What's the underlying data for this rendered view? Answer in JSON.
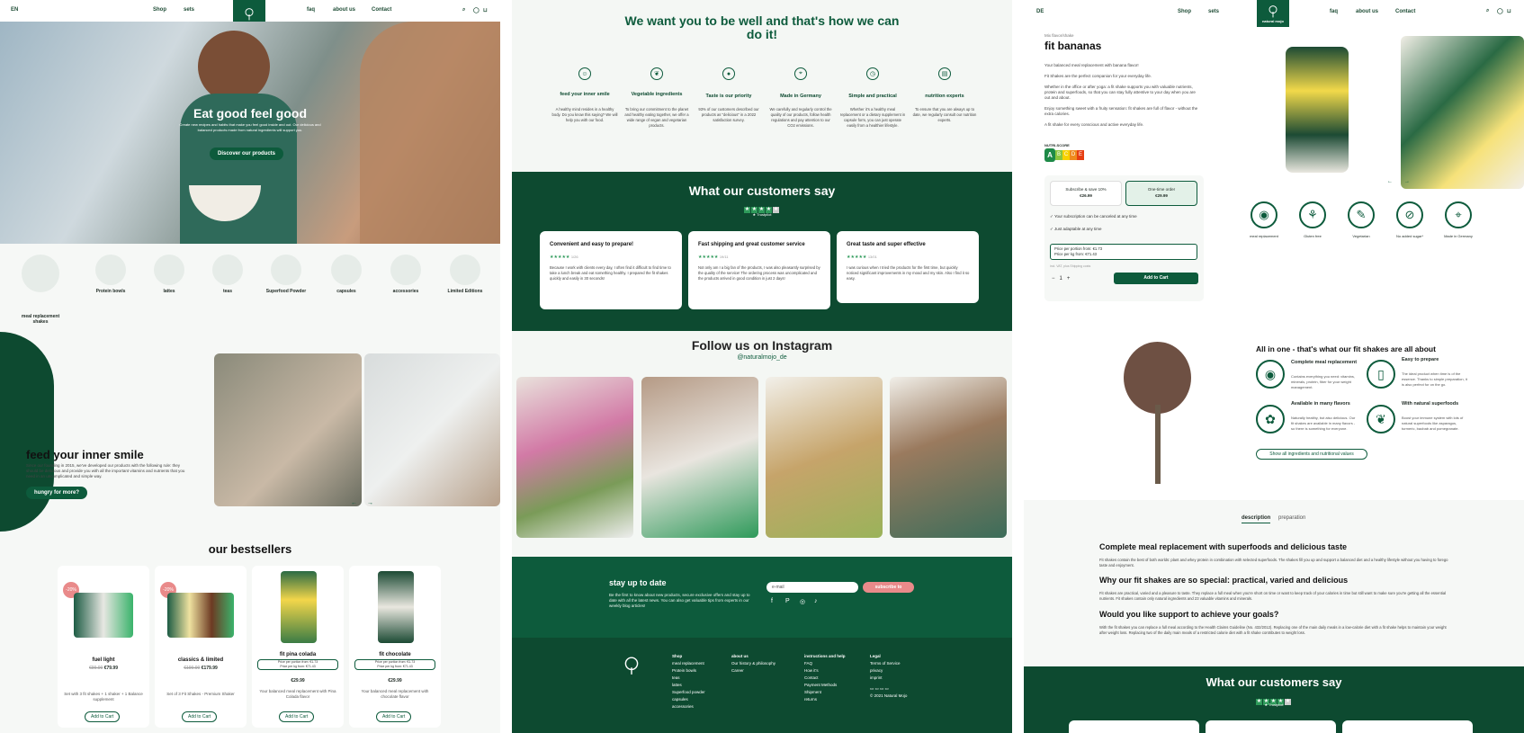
{
  "nav": {
    "lang": "EN",
    "shop": "Shop",
    "sets": "sets",
    "faq": "faq",
    "about": "about us",
    "contact": "Contact",
    "logo_text": "natural mojo",
    "lang2": "DE"
  },
  "hero": {
    "title": "Eat good feel good",
    "subtitle": "Create new recipes and habits that make you feel good inside and out. Our delicious and balanced products made from natural ingredients will support you.",
    "cta": "Discover our products"
  },
  "categories": [
    {
      "label": "meal replacement shakes"
    },
    {
      "label": "Protein bowls"
    },
    {
      "label": "lattes"
    },
    {
      "label": "teas"
    },
    {
      "label": "Superfood Powder"
    },
    {
      "label": "capsules"
    },
    {
      "label": "accessories"
    },
    {
      "label": "Limited Editions"
    }
  ],
  "inner_smile": {
    "title": "feed your inner smile",
    "text": "Since our founding in 2015, we've developed our products with the following rule: they should be delicious and provide you with all the important vitamins and nutrients that you need in an uncomplicated and simple way.",
    "cta": "hungry for more?"
  },
  "bestsellers": {
    "title": "our bestsellers",
    "products": [
      {
        "name": "fuel light",
        "price": "€79.99",
        "old": "€99.99",
        "badge": "-20%",
        "desc": "Set with 3 fit shakes + 1 shaker + 1 Balance supplement",
        "cta": "Add to Cart"
      },
      {
        "name": "classics & limited",
        "price": "€179.99",
        "old": "€199.99",
        "badge": "-20%",
        "desc": "Set of 3 Fit Shakes - Premium Shaker",
        "cta": "Add to Cart"
      },
      {
        "name": "fit pina colada",
        "price": "€29.99",
        "sub1": "Price per portion from: €1.73",
        "sub2": "Price per kg from: €71.43",
        "desc": "Your balanced meal replacement with Pina Colada flavor",
        "cta": "Add to Cart"
      },
      {
        "name": "fit chocolate",
        "price": "€29.99",
        "sub1": "Price per portion from: €1.73",
        "sub2": "Price per kg from: €71.43",
        "desc": "Your balanced meal replacement with chocolate flavor",
        "cta": "Add to Cart"
      }
    ]
  },
  "values": {
    "title": "We want you to be well and that's how we can do it!",
    "items": [
      {
        "title": "feed your inner smile",
        "text": "A healthy mind resides in a healthy body. Do you know this saying? We will help you with our food.",
        "icon": "smile-icon"
      },
      {
        "title": "Vegetable ingredients",
        "text": "To bring our commitment to the planet and healthy eating together, we offer a wide range of vegan and vegetarian products.",
        "icon": "leaf-icon"
      },
      {
        "title": "Taste is our priority",
        "text": "93% of our customers described our products as \"delicious\" in a 2022 satisfaction survey.",
        "icon": "apple-icon"
      },
      {
        "title": "Made in Germany",
        "text": "We carefully and regularly control the quality of our products, follow health regulations and pay attention to our CO2 emissions.",
        "icon": "pin-icon"
      },
      {
        "title": "Simple and practical",
        "text": "Whether it's a healthy meal replacement or a dietary supplement in capsule form, you can just operate easily from a healthier lifestyle.",
        "icon": "clock-icon"
      },
      {
        "title": "nutrition experts",
        "text": "To ensure that you are always up to date, we regularly consult our nutrition experts.",
        "icon": "book-icon"
      }
    ]
  },
  "reviews": {
    "title": "What our customers say",
    "trustpilot": "Trustpilot",
    "items": [
      {
        "title": "Convenient and easy to prepare!",
        "date": "1/26",
        "text": "Because I work with clients every day, I often find it difficult to find time to take a lunch break and eat something healthy. I prepared the fit shakes quickly and easily in 30 seconds!"
      },
      {
        "title": "Fast shipping and great customer service",
        "date": "19/11",
        "text": "Not only am I a big fan of the products, I was also pleasantly surprised by the quality of the service! The ordering process was uncomplicated and the products arrived in good condition in just 2 days!"
      },
      {
        "title": "Great taste and super effective",
        "date": "13/01",
        "text": "I was curious when I tried the products for the first time, but quickly noticed significant improvements in my mood and my skin. Also I find it so easy."
      }
    ]
  },
  "instagram": {
    "title": "Follow us on Instagram",
    "handle": "@naturalmojo_de"
  },
  "newsletter": {
    "title": "stay up to date",
    "text": "Be the first to know about new products, secure exclusive offers and stay up to date with all the latest news. You can also get valuable tips from experts in our weekly blog articles!",
    "placeholder": "e-mail",
    "cta": "subscribe to"
  },
  "footer": {
    "cols": [
      {
        "head": "Shop",
        "items": [
          "meal replacement",
          "Protein bowls",
          "teas",
          "lattes",
          "Superfood powder",
          "capsules",
          "accessories"
        ]
      },
      {
        "head": "about us",
        "items": [
          "Our history & philosophy",
          "Career"
        ]
      },
      {
        "head": "instructions and help",
        "items": [
          "FAQ",
          "How it's",
          "Contact",
          "Payment Methods",
          "Shipment",
          "returns"
        ]
      },
      {
        "head": "Legal",
        "items": [
          "Terms of Service",
          "privacy",
          "imprint"
        ]
      }
    ],
    "copyright": "© 2021 Natural Mojo"
  },
  "product": {
    "breadcrumb": "Mix flavor/shake",
    "title": "fit bananas",
    "subtitle": "Your balanced meal replacement with banana flavor!",
    "p1": "Fit Shakes are the perfect companion for your everyday life.",
    "p2": "Whether in the office or after yoga: a fit shake supports you with valuable nutrients, protein and superfoods, so that you can stay fully attentive to your day when you are out and about.",
    "p3": "Enjoy something sweet with a fruity sensation: fit shakes are full of flavor - without the extra calories.",
    "p4": "A fit shake for every conscious and active everyday life.",
    "nutri_label": "NUTRI-SCORE",
    "nutri": [
      "A",
      "B",
      "C",
      "D",
      "E"
    ],
    "opt1_label": "Subscribe & save 10%",
    "opt1_price": "€26.99",
    "opt2_label": "One-time order",
    "opt2_price": "€29.99",
    "note1": "Your subscription can be canceled at any time",
    "note2": "Just adaptable at any time",
    "price_portion": "Price per portion from: €1.73",
    "price_kg": "Price per kg from: €71.43",
    "shipping": "incl. VAT, plus Shipping costs",
    "qty": "1",
    "cta": "Add to Cart",
    "features": [
      "meal replacement",
      "Gluten free",
      "Vegetarian",
      "No added sugar*",
      "Made in Germany"
    ]
  },
  "allinone": {
    "title": "All in one - that's what our fit shakes are all about",
    "items": [
      {
        "title": "Complete meal replacement",
        "text": "Contains everything you need: vitamins, minerals, protein, fiber for your weight management."
      },
      {
        "title": "Easy to prepare",
        "text": "The ideal product when time is of the essence. Thanks to simple preparation, it is also perfect for on the go."
      },
      {
        "title": "Available in many flavors",
        "text": "Naturally healthy, but also delicious. Our fit shakes are available in many flavors - so there is something for everyone."
      },
      {
        "title": "With natural superfoods",
        "text": "Boost your immune system with lots of natural superfoods like asparagus, turmeric, baobab and pomegranate."
      }
    ],
    "cta": "Show all ingredients and nutritional values"
  },
  "tabs": [
    "description",
    "preparation"
  ],
  "desc": {
    "h1": "Complete meal replacement with superfoods and delicious taste",
    "t1": "Fit shakes contain the best of both worlds: plant and whey protein in combination with selected superfoods. The shakes fill you up and support a balanced diet and a healthy lifestyle without you having to forego taste and enjoyment.",
    "h2": "Why our fit shakes are so special: practical, varied and delicious",
    "t2": "Fit shakes are practical, varied and a pleasure to taste. They replace a full meal when you're short on time or want to keep track of your calories in time but still want to make sure you're getting all the essential nutrients. Fit shakes contain only natural ingredients and 23 valuable vitamins and minerals.",
    "h3": "Would you like support to achieve your goals?",
    "t3": "With the fit shakes you can replace a full meal according to the Health Claims Guideline (No. 432/2012). Replacing one of the main daily meals in a low-calorie diet with a fit shake helps to maintain your weight after weight loss. Replacing two of the daily main meals of a restricted calorie diet with a fit shake contributes to weight loss."
  },
  "reviews2": {
    "title": "What our customers say"
  },
  "colors": {
    "brand": "#0d5b3c",
    "dark": "#0d4a30",
    "accent": "#e98a8a"
  }
}
